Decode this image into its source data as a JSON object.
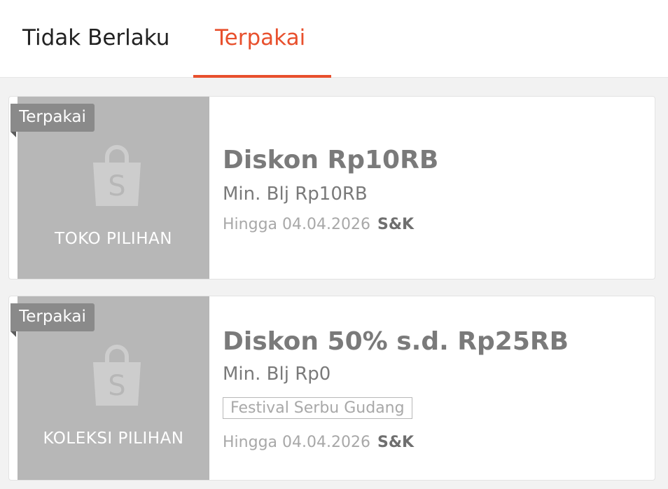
{
  "tabs": {
    "inactive_label": "Tidak Berlaku",
    "active_label": "Terpakai"
  },
  "colors": {
    "accent": "#e8502d",
    "stub_gray": "#b7b7b7",
    "badge_gray": "#8a8a8a"
  },
  "vouchers": [
    {
      "badge": "Terpakai",
      "shop_label": "TOKO PILIHAN",
      "icon": "shopee-bag-icon",
      "title": "Diskon Rp10RB",
      "min_spend": "Min. Blj Rp10RB",
      "expiry": "Hingga 04.04.2026",
      "terms": "S&K"
    },
    {
      "badge": "Terpakai",
      "shop_label": "KOLEKSI PILIHAN",
      "icon": "shopee-bag-icon",
      "title": "Diskon 50% s.d. Rp25RB",
      "min_spend": "Min. Blj Rp0",
      "tag": "Festival Serbu Gudang",
      "expiry": "Hingga 04.04.2026",
      "terms": "S&K"
    }
  ]
}
